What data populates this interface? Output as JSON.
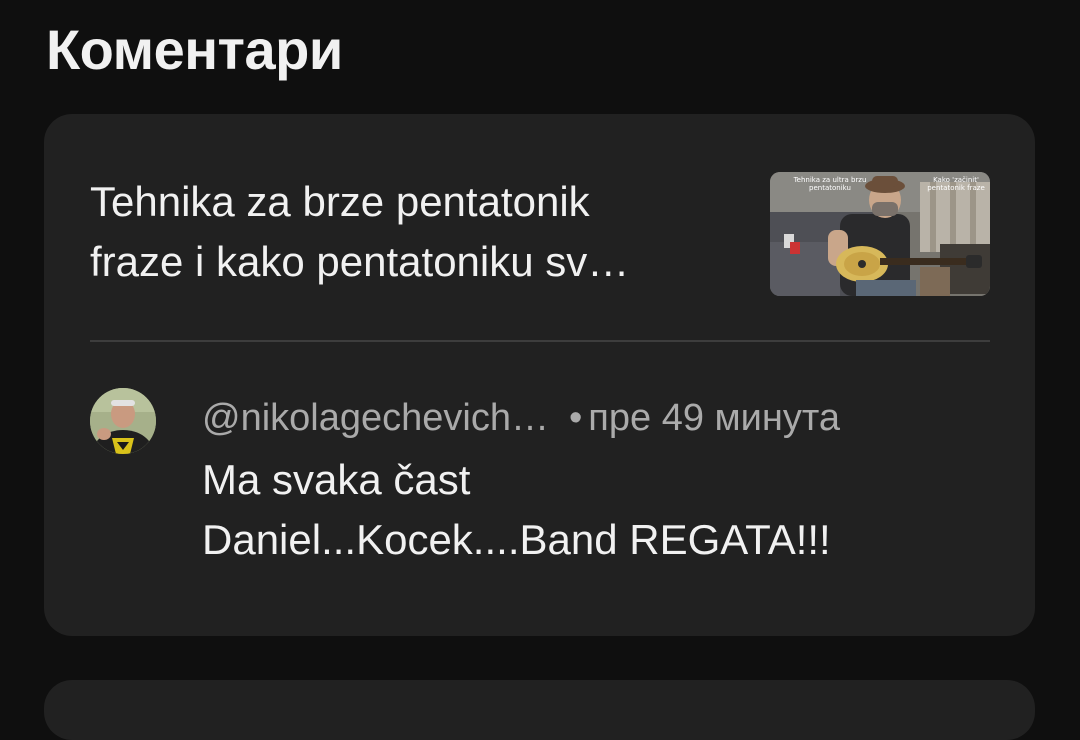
{
  "section": {
    "title": "Коментари"
  },
  "video": {
    "title_line1": "Tehnika za brze pentatonik",
    "title_line2": "fraze i kako pentatoniku sv…",
    "thumb_caption_left": "Tehnika za ultra brzu pentatoniku",
    "thumb_caption_right": "Kako 'začinit' pentatonik fraze"
  },
  "comment": {
    "author": "@nikolagechevich…",
    "dot": "•",
    "time": "пре 49 минута",
    "text_line1": "Ma svaka čast",
    "text_line2": "Daniel...Kocek....Band REGATA!!!"
  },
  "colors": {
    "background": "#0f0f0f",
    "card": "#212121",
    "primary_text": "#f1f1f1",
    "secondary_text": "#aaaaaa",
    "divider": "#3d3d3d"
  }
}
